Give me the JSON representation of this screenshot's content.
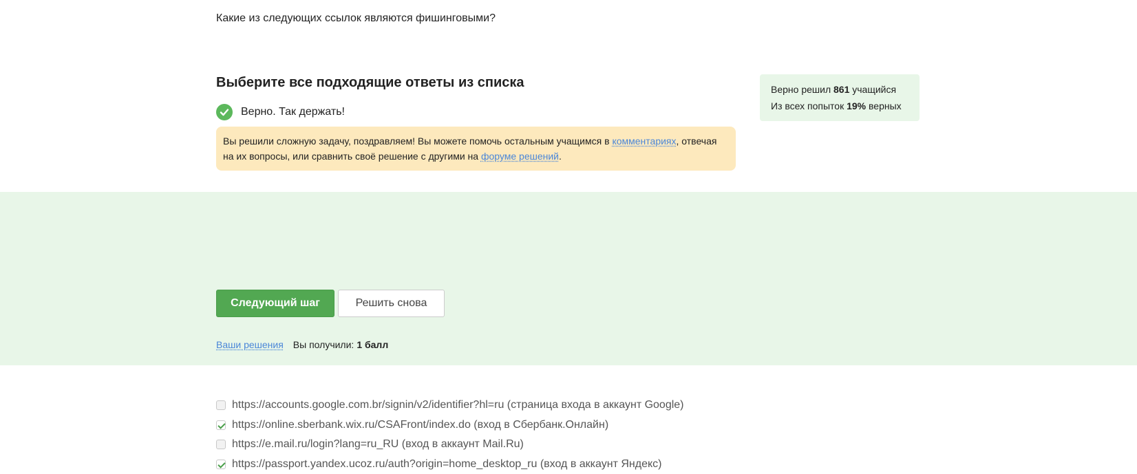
{
  "question": "Какие из следующих ссылок являются фишинговыми?",
  "heading": "Выберите все подходящие ответы из списка",
  "status": {
    "text": "Верно. Так держать!",
    "color": "#5cb85c"
  },
  "notice": {
    "part1": "Вы решили сложную задачу, поздравляем! Вы можете помочь остальным учащимся в ",
    "link1": "комментариях",
    "part2": ", отвечая на их вопросы, или сравнить своё решение с другими на ",
    "link2": "форуме решений",
    "part3": "."
  },
  "stats": {
    "solved_prefix": "Верно решил",
    "solved_count": "861",
    "solved_suffix": "учащийся",
    "attempts_prefix": "Из всех попыток",
    "attempts_percent": "19%",
    "attempts_suffix": "верных"
  },
  "options": [
    {
      "text": "https://accounts.google.com.br/signin/v2/identifier?hl=ru (страница входа в аккаунт Google)",
      "checked": false
    },
    {
      "text": "https://online.sberbank.wix.ru/CSAFront/index.do (вход в Сбербанк.Онлайн)",
      "checked": true
    },
    {
      "text": "https://e.mail.ru/login?lang=ru_RU (вход в аккаунт Mail.Ru)",
      "checked": false
    },
    {
      "text": "https://passport.yandex.ucoz.ru/auth?origin=home_desktop_ru (вход в аккаунт Яндекс)",
      "checked": true
    }
  ],
  "buttons": {
    "next": "Следующий шаг",
    "retry": "Решить снова"
  },
  "footer": {
    "solutions_link": "Ваши решения",
    "score_label": "Вы получили:",
    "score_value": "1 балл"
  },
  "colors": {
    "accent": "#52a852",
    "success_bg": "#e8f6e8",
    "notice_bg": "#fde9bd",
    "link": "#4a86d8"
  }
}
